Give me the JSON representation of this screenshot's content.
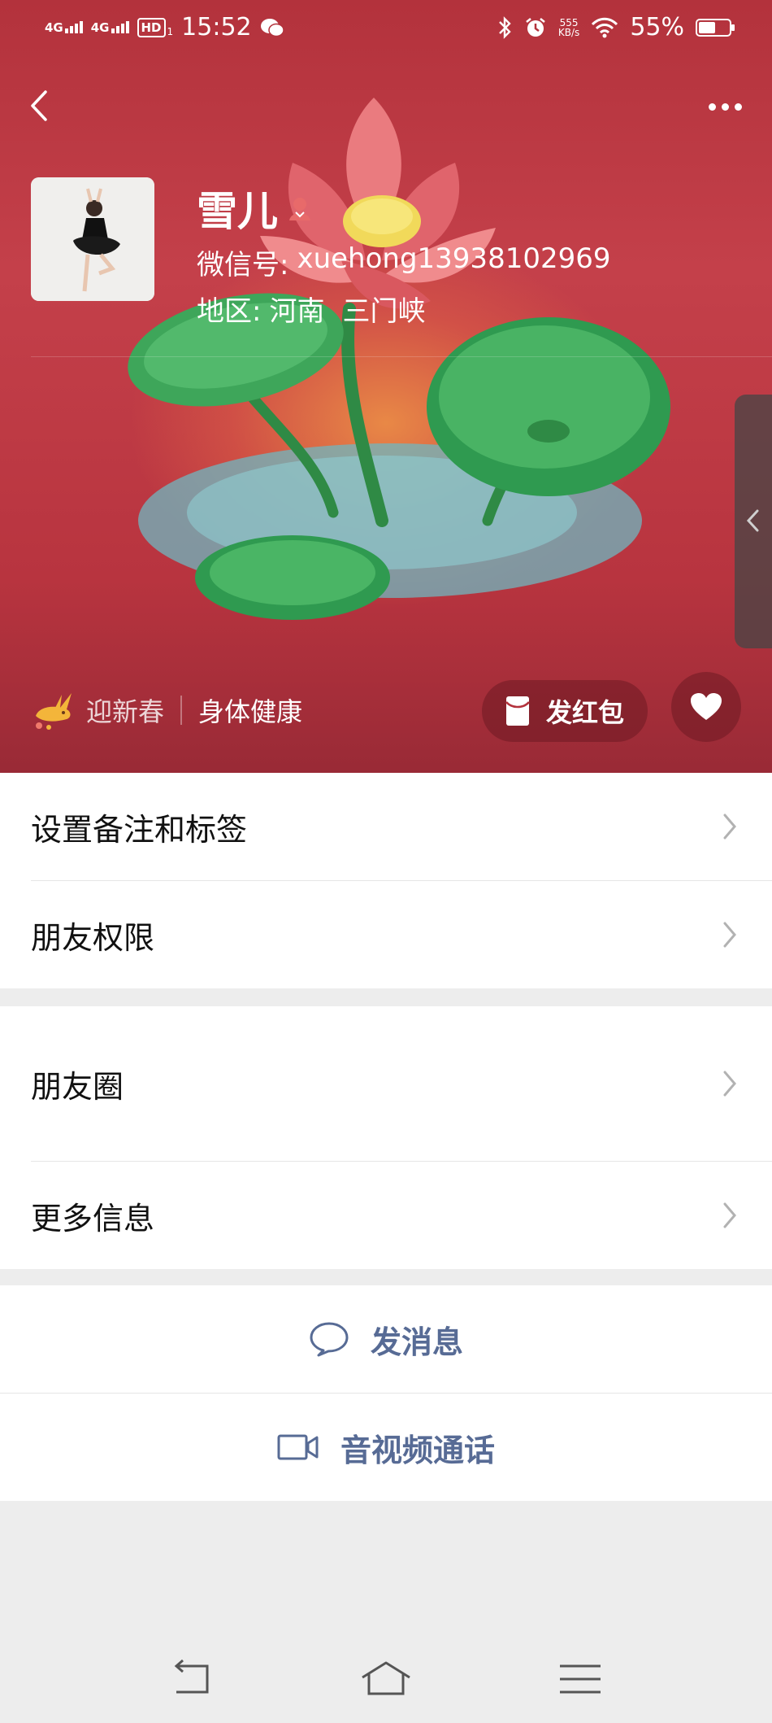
{
  "status_bar": {
    "network1": "4G",
    "network2": "4G",
    "hd": "HD",
    "hd_sub": "1",
    "time": "15:52",
    "net_speed_value": "555",
    "net_speed_unit": "KB/s",
    "battery": "55%",
    "battery_level": 0.55
  },
  "profile": {
    "name": "雪儿",
    "wechat_id_label": "微信号:",
    "wechat_id": "xuehong13938102969",
    "region_label": "地区:",
    "region_province": "河南",
    "region_city": "三门峡"
  },
  "status": {
    "tag": "迎新春",
    "text": "身体健康"
  },
  "actions": {
    "red_packet": "发红包"
  },
  "menu_section1": [
    {
      "label": "设置备注和标签"
    },
    {
      "label": "朋友权限"
    }
  ],
  "menu_section2": [
    {
      "label": "朋友圈"
    },
    {
      "label": "更多信息"
    }
  ],
  "bottom_actions": {
    "message": "发消息",
    "call": "音视频通话"
  },
  "colors": {
    "cover_red": "#b3323c",
    "link_blue": "#576b95",
    "background": "#ededed"
  },
  "icons": [
    "back-arrow-icon",
    "more-dots-icon",
    "female-icon",
    "rabbit-icon",
    "red-packet-icon",
    "heart-icon",
    "chevron-right-icon",
    "chat-bubble-icon",
    "video-camera-icon",
    "nav-back-icon",
    "nav-home-icon",
    "nav-menu-icon"
  ]
}
